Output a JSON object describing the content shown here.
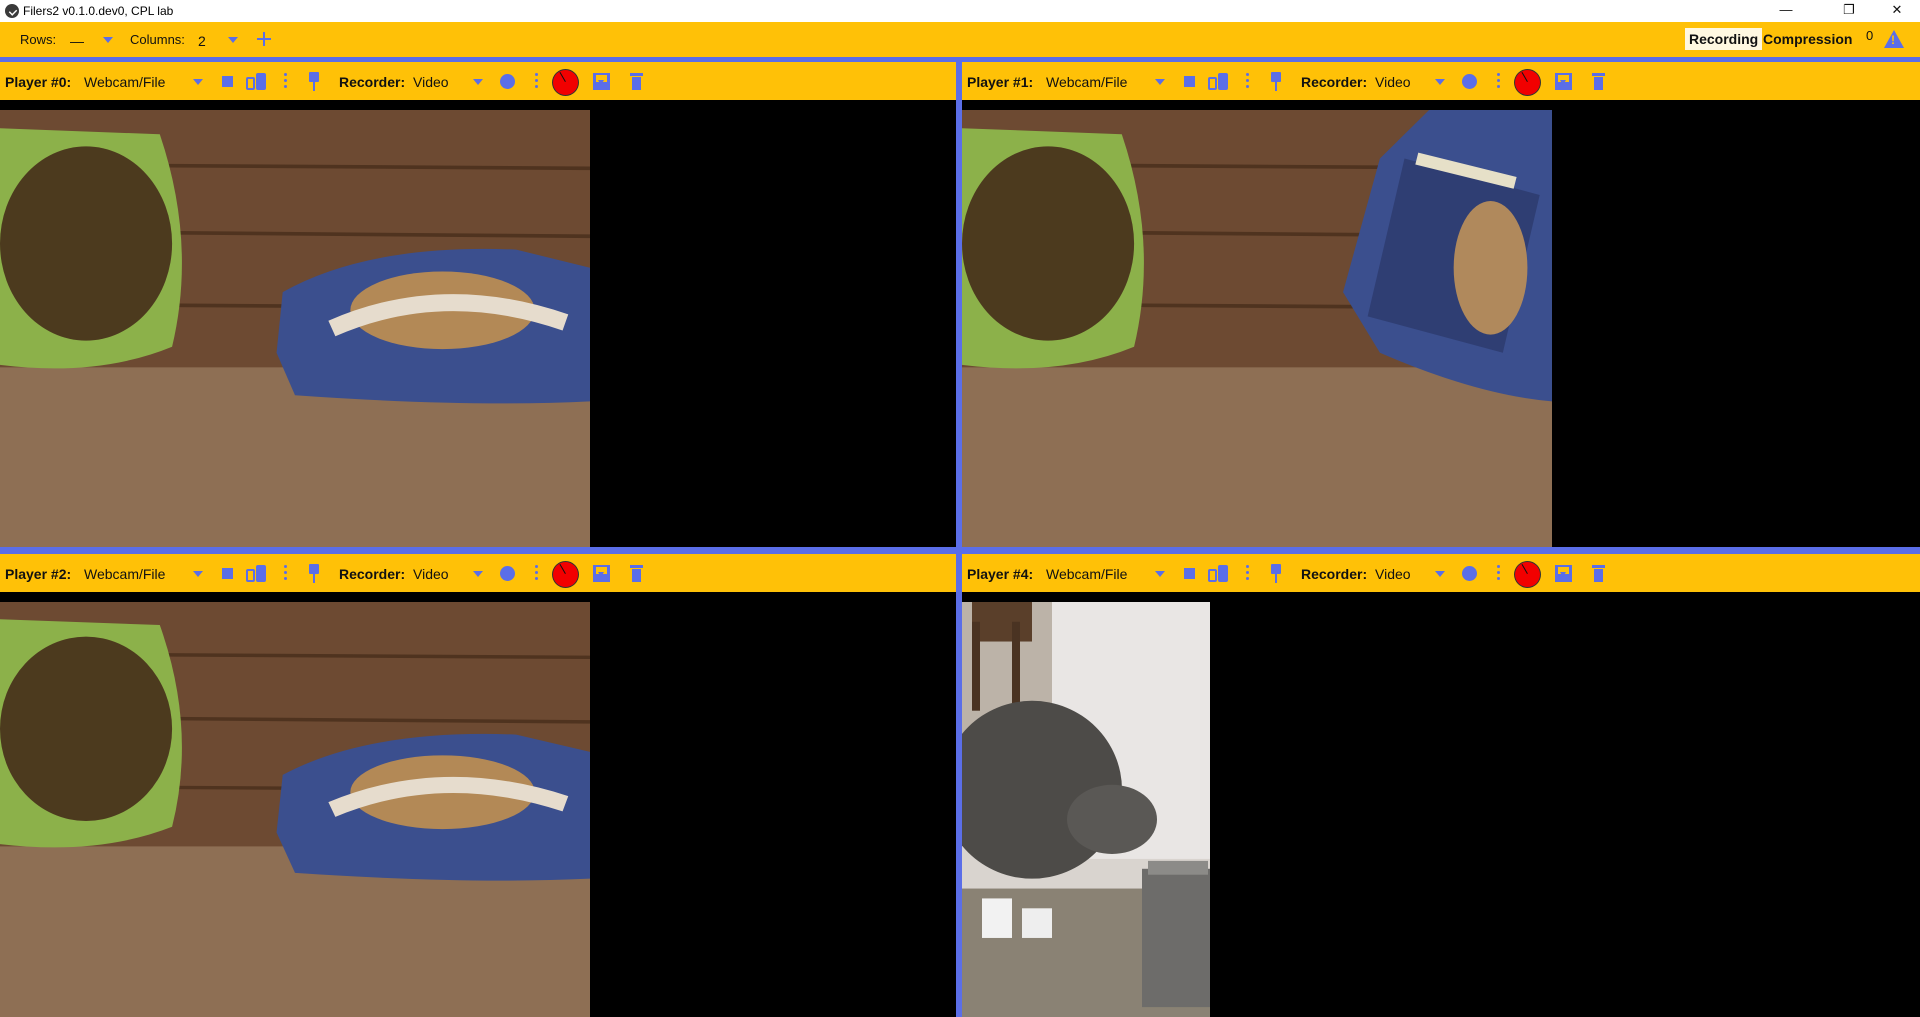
{
  "window": {
    "title": "Filers2 v0.1.0.dev0, CPL lab",
    "minimize": "—",
    "maximize": "❐",
    "close": "✕"
  },
  "toolbar": {
    "rows_label": "Rows:",
    "rows_value": "—",
    "columns_label": "Columns:",
    "columns_value": "2",
    "tab_recording": "Recording",
    "tab_compression": "Compression",
    "error_count": "0"
  },
  "players": [
    {
      "label": "Player #0:",
      "source": "Webcam/File",
      "recorder_label": "Recorder:",
      "recorder": "Video",
      "scene": "bag-flat"
    },
    {
      "label": "Player #1:",
      "source": "Webcam/File",
      "recorder_label": "Recorder:",
      "recorder": "Video",
      "scene": "bag-upright"
    },
    {
      "label": "Player #2:",
      "source": "Webcam/File",
      "recorder_label": "Recorder:",
      "recorder": "Video",
      "scene": "bag-flat"
    },
    {
      "label": "Player #4:",
      "source": "Webcam/File",
      "recorder_label": "Recorder:",
      "recorder": "Video",
      "scene": "cat"
    }
  ],
  "colors": {
    "toolbar": "#FFC107",
    "accent": "#5b6ee8",
    "record": "#f20000"
  }
}
